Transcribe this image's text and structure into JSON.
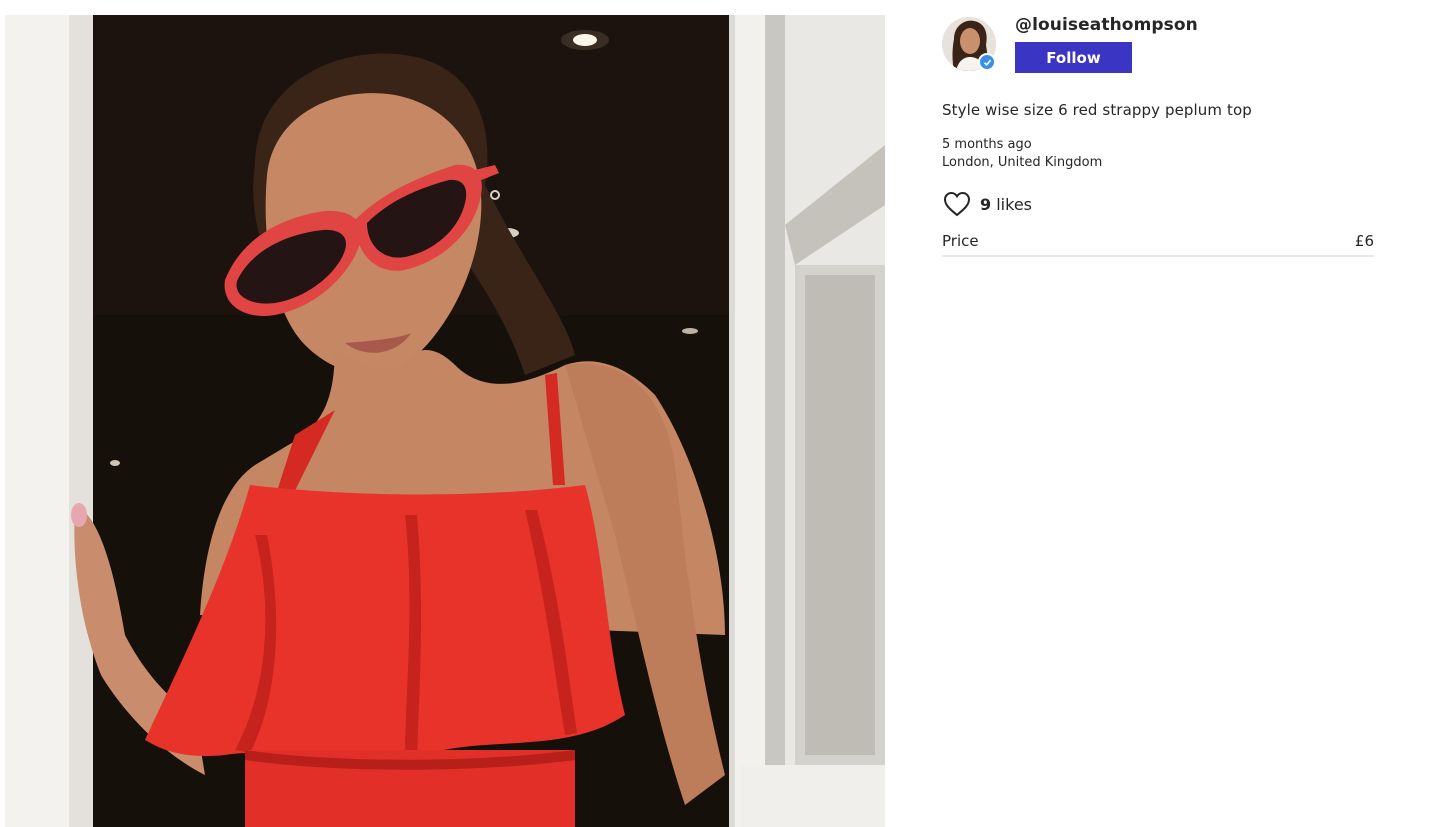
{
  "listing": {
    "photo_alt": "",
    "seller": {
      "username": "@louiseathompson",
      "verified": true,
      "follow_label": "Follow"
    },
    "description": "Style wise size 6 red strappy peplum top",
    "posted": "5 months ago",
    "location": "London, United Kingdom",
    "likes": {
      "count": "9",
      "label": "likes"
    },
    "price": {
      "label": "Price",
      "value": "£6"
    }
  },
  "colors": {
    "follow_button": "#3a35c3",
    "verified_badge": "#3b8fe8",
    "top": "#e8332b",
    "background_dark": "#1c130e"
  },
  "icons": {
    "like": "heart-outline-icon",
    "verified": "verified-check-icon"
  }
}
